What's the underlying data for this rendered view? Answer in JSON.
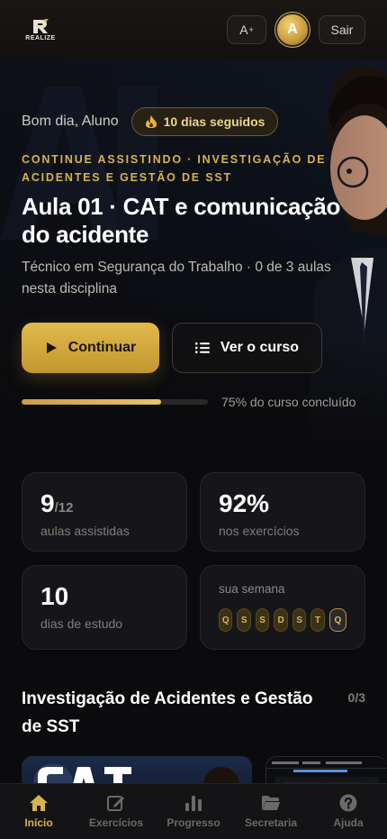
{
  "header": {
    "logo_text": "REALIZE",
    "font_button": "A",
    "font_button_sup": "+",
    "avatar_initial": "A",
    "logout_label": "Sair"
  },
  "hero": {
    "greeting": "Bom dia, Aluno",
    "streak": "10 dias seguidos",
    "kicker": "Continue assistindo · Investigação de Acidentes e Gestão de SST",
    "title": "Aula 01 · CAT e comunicação do acidente",
    "subtitle": "Técnico em Segurança do Trabalho · 0 de 3 aulas nesta disciplina",
    "continue_label": "Continuar",
    "course_label": "Ver o curso",
    "progress_value": 0.75,
    "progress_label": "75% do curso concluído"
  },
  "stats": {
    "lessons_watched": "9",
    "lessons_total": "/12",
    "lessons_label": "aulas assistidas",
    "exercises_pct": "92%",
    "exercises_label": "nos exercícios",
    "study_days": "10",
    "study_days_label": "dias de estudo",
    "week_label": "sua semana",
    "week_days": [
      "Q",
      "S",
      "S",
      "D",
      "S",
      "T",
      "Q"
    ]
  },
  "section": {
    "title": "Investigação de Acidentes e Gestão de SST",
    "count": "0/3"
  },
  "nav": {
    "items": [
      {
        "label": "Início",
        "icon": "home-icon"
      },
      {
        "label": "Exercícios",
        "icon": "edit-icon"
      },
      {
        "label": "Progresso",
        "icon": "bar-chart-icon"
      },
      {
        "label": "Secretaria",
        "icon": "folder-icon"
      },
      {
        "label": "Ajuda",
        "icon": "help-icon"
      }
    ]
  },
  "colors": {
    "accent": "#d8b24c",
    "background": "#0b0b0d",
    "card": "#16161a"
  }
}
